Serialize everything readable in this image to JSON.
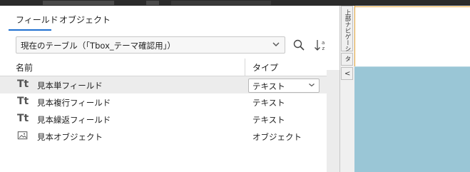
{
  "tabs": [
    {
      "label": "フィールド",
      "active": true
    },
    {
      "label": "オブジェクト",
      "active": false
    }
  ],
  "selector": {
    "value": "現在のテーブル（「Tbox_テーマ確認用」）"
  },
  "icons": {
    "search": "search-icon",
    "sort": "sort-az-icon",
    "chevron": "chevron-down-icon"
  },
  "columns": {
    "name": "名前",
    "type": "タイプ"
  },
  "rows": [
    {
      "icon": "Tt",
      "name": "見本単フィールド",
      "type": "テキスト",
      "selected": true
    },
    {
      "icon": "Tt",
      "name": "見本複行フィールド",
      "type": "テキスト",
      "selected": false
    },
    {
      "icon": "Tt",
      "name": "見本繰返フィールド",
      "type": "テキスト",
      "selected": false
    },
    {
      "icon": "image",
      "name": "見本オブジェクト",
      "type": "オブジェクト",
      "selected": false
    }
  ],
  "side_tabs": {
    "nav": "上部ナビゲーション",
    "t": "タ",
    "arrow": "<"
  },
  "colors": {
    "accent": "#1e6fd0",
    "canvas": "#9ac6d6",
    "border_orange": "#e4a63a"
  }
}
